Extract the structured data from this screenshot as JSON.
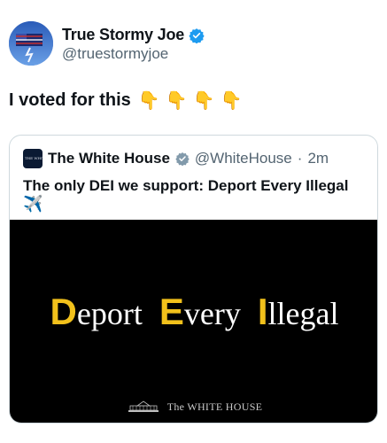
{
  "author": {
    "display_name": "True Stormy Joe",
    "handle": "@truestormyjoe",
    "verified": true,
    "verified_color": "#1d9bf0"
  },
  "tweet": {
    "text": "I voted for this",
    "emojis": [
      "👇",
      "👇",
      "👇",
      "👇"
    ]
  },
  "quoted_tweet": {
    "avatar_text": "THE WHITE HOUSE",
    "display_name": "The White House",
    "verified_color": "#829aab",
    "handle": "@WhiteHouse",
    "separator": "·",
    "time": "2m",
    "text": "The only DEI we support: Deport Every Illegal",
    "emoji": "✈️",
    "media": {
      "background": "#000000",
      "accent_color": "#f2c11b",
      "words": [
        {
          "first": "D",
          "rest": "eport"
        },
        {
          "first": "E",
          "rest": "very"
        },
        {
          "first": "I",
          "rest": "llegal"
        }
      ],
      "footer_label": "The WHITE HOUSE"
    }
  }
}
